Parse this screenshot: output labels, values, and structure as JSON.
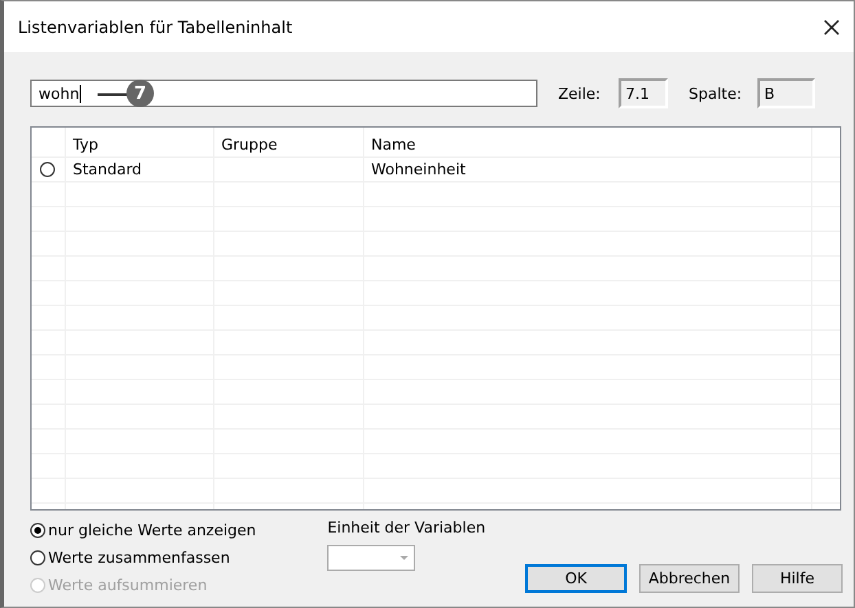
{
  "window": {
    "title": "Listenvariablen für Tabelleninhalt"
  },
  "search": {
    "value": "wohn"
  },
  "callout": {
    "number": "7"
  },
  "position": {
    "row_label": "Zeile:",
    "row_value": "7.1",
    "column_label": "Spalte:",
    "column_value": "B"
  },
  "table": {
    "columns": [
      "Typ",
      "Gruppe",
      "Name"
    ],
    "rows": [
      {
        "selected": false,
        "type": "Standard",
        "group": "",
        "name": "Wohneinheit"
      }
    ]
  },
  "options": [
    {
      "label": "nur gleiche Werte anzeigen",
      "selected": true,
      "disabled": false
    },
    {
      "label": "Werte zusammenfassen",
      "selected": false,
      "disabled": false
    },
    {
      "label": "Werte aufsummieren",
      "selected": false,
      "disabled": true
    }
  ],
  "unit": {
    "label": "Einheit der Variablen"
  },
  "buttons": [
    {
      "label": "OK",
      "default": true
    },
    {
      "label": "Abbrechen",
      "default": false
    },
    {
      "label": "Hilfe",
      "default": false
    }
  ]
}
